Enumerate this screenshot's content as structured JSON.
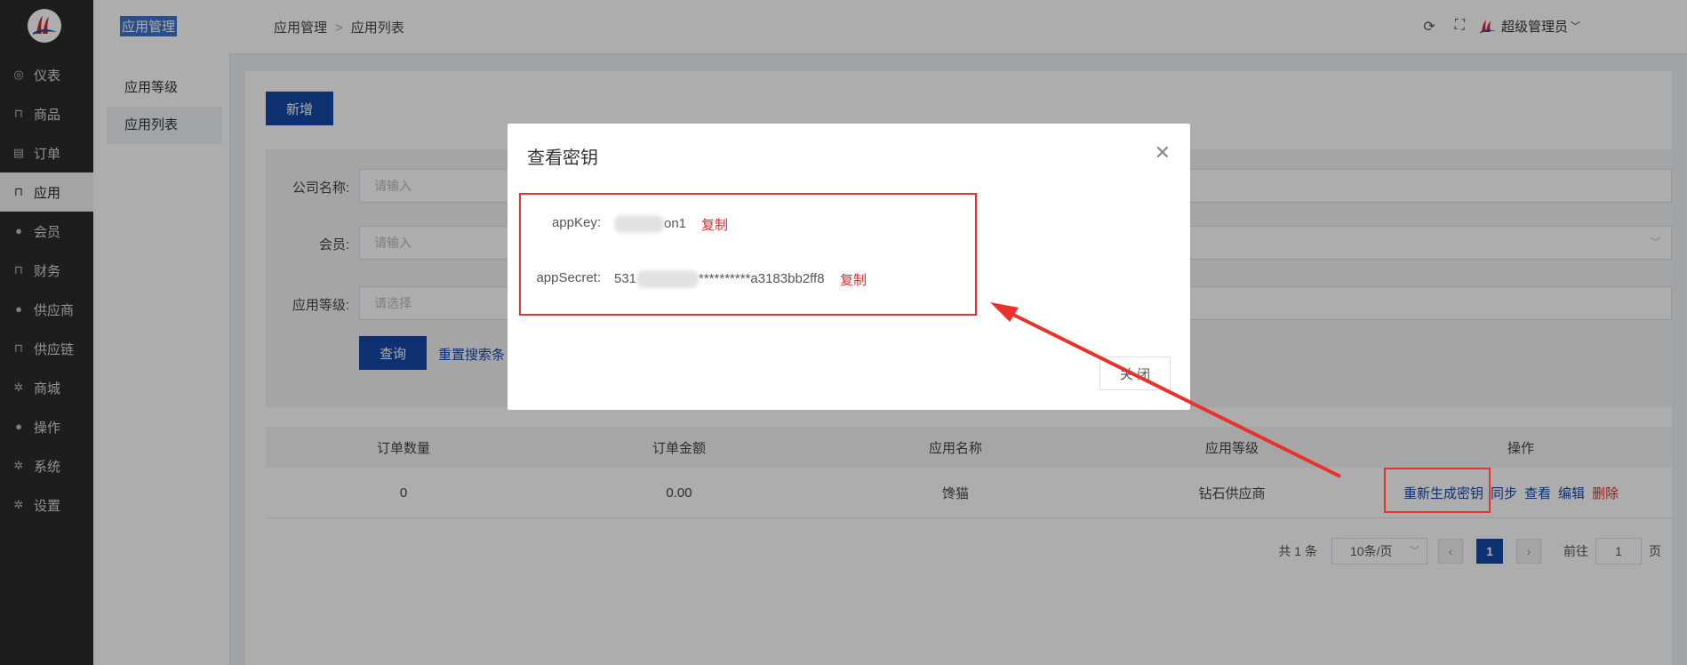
{
  "sidebar": {
    "items": [
      {
        "label": "仪表",
        "icon": "dashboard-icon",
        "glyph": "◎"
      },
      {
        "label": "商品",
        "icon": "bag-icon",
        "glyph": "⊓"
      },
      {
        "label": "订单",
        "icon": "clipboard-icon",
        "glyph": "▤"
      },
      {
        "label": "应用",
        "icon": "bag-icon",
        "glyph": "⊓"
      },
      {
        "label": "会员",
        "icon": "user-icon",
        "glyph": "●"
      },
      {
        "label": "财务",
        "icon": "bag-icon",
        "glyph": "⊓"
      },
      {
        "label": "供应商",
        "icon": "user-icon",
        "glyph": "●"
      },
      {
        "label": "供应链",
        "icon": "bag-icon",
        "glyph": "⊓"
      },
      {
        "label": "商城",
        "icon": "gear-icon",
        "glyph": "✲"
      },
      {
        "label": "操作",
        "icon": "user-icon",
        "glyph": "●"
      },
      {
        "label": "系统",
        "icon": "gear-icon",
        "glyph": "✲"
      },
      {
        "label": "设置",
        "icon": "gear-icon",
        "glyph": "✲"
      }
    ],
    "active_index": 3
  },
  "submenu": {
    "title": "应用管理",
    "items": [
      "应用等级",
      "应用列表"
    ]
  },
  "header": {
    "breadcrumb": [
      "应用管理",
      "应用列表"
    ],
    "user_name": "超级管理员"
  },
  "main": {
    "add_button": "新增",
    "form": {
      "company_label": "公司名称:",
      "company_placeholder": "请输入",
      "member_label": "会员:",
      "member_placeholder": "请输入",
      "level_label": "应用等级:",
      "level_placeholder": "请选择",
      "query_button": "查询",
      "reset_link": "重置搜索条"
    },
    "table": {
      "headers": [
        "订单数量",
        "订单金额",
        "应用名称",
        "应用等级",
        "操作"
      ],
      "rows": [
        {
          "order_count": "0",
          "order_amount": "0.00",
          "app_name": "馋猫",
          "app_level": "钻石供应商"
        }
      ],
      "actions": {
        "regenerate": "重新生成密钥",
        "sync": "同步",
        "view": "查看",
        "edit": "编辑",
        "delete": "删除"
      }
    },
    "pagination": {
      "total": "共 1 条",
      "page_size": "10条/页",
      "current_page": "1",
      "goto_prefix": "前往",
      "goto_value": "1",
      "goto_suffix": "页"
    }
  },
  "dialog": {
    "title": "查看密钥",
    "app_key_label": "appKey:",
    "app_key_suffix": "on1",
    "app_secret_label": "appSecret:",
    "app_secret_prefix": "531",
    "app_secret_suffix": "**********a3183bb2ff8",
    "copy_label": "复制",
    "close_button": "关 闭"
  },
  "colors": {
    "primary": "#1348a6",
    "danger": "#e4282b",
    "sidebar_bg": "#2b2b2b",
    "annotation_red": "#e8322b"
  }
}
